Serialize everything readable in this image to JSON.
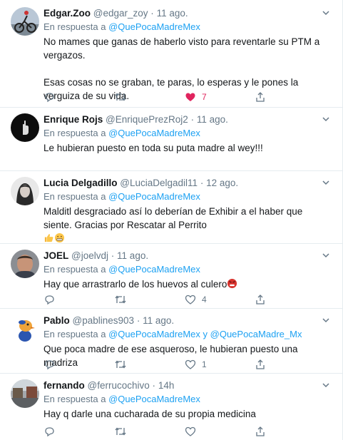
{
  "reply_prefix": "En respuesta a",
  "tweets": [
    {
      "name": "Edgar.Zoo",
      "handle": "@edgar_zoy",
      "time": "11 ago.",
      "mentions": [
        "@QuePocaMadreMex"
      ],
      "text": "No mames que ganas de haberlo visto para reventarle su PTM a vergazos.\n\nEsas cosas no se graban, te paras, lo esperas y le pones la verguiza de su vida.",
      "reply_count": "",
      "retweet_count": "",
      "like_count": "7",
      "liked": true,
      "avatar": "avatar-cyclist"
    },
    {
      "name": "Enrique Rojs",
      "handle": "@EnriquePrezRoj2",
      "time": "11 ago.",
      "mentions": [
        "@QuePocaMadreMex"
      ],
      "text": "Le hubieran puesto en toda su puta madre al wey!!!",
      "reply_count": "",
      "retweet_count": "",
      "like_count": "",
      "liked": false,
      "avatar": "avatar-dark-hand"
    },
    {
      "name": "Lucia Delgadillo",
      "handle": "@LuciaDelgadil11",
      "time": "12 ago.",
      "mentions": [
        "@QuePocaMadreMex"
      ],
      "text": "Malditl desgraciado así lo deberían  de Exhibir  a el haber que siente. Gracias  por Rescatar al Perrito",
      "text_emojis": [
        "thumbs-up-emoji",
        "grimacing-emoji"
      ],
      "reply_count": "",
      "retweet_count": "",
      "like_count": "",
      "liked": false,
      "avatar": "avatar-woman"
    },
    {
      "name": "JOEL",
      "handle": "@joelvdj",
      "time": "11 ago.",
      "mentions": [
        "@QuePocaMadreMex"
      ],
      "text": "Hay que arrastrarlo de los huevos al culero",
      "text_emojis": [
        "angry-face-emoji"
      ],
      "reply_count": "",
      "retweet_count": "",
      "like_count": "4",
      "liked": false,
      "avatar": "avatar-man"
    },
    {
      "name": "Pablo",
      "handle": "@pablines903",
      "time": "11 ago.",
      "mentions": [
        "@QuePocaMadreMex",
        "@QuePocaMadre_Mx"
      ],
      "mention_join": "y",
      "text": "Que poca madre de ese asqueroso, le hubieran puesto una madriza",
      "reply_count": "",
      "retweet_count": "",
      "like_count": "1",
      "liked": false,
      "avatar": "avatar-cartoon"
    },
    {
      "name": "fernando",
      "handle": "@ferrucochivo",
      "time": "14h",
      "mentions": [
        "@QuePocaMadreMex"
      ],
      "text": "Hay q darle una cucharada de su propia medicina",
      "reply_count": "",
      "retweet_count": "",
      "like_count": "",
      "liked": false,
      "avatar": "avatar-street"
    }
  ],
  "colors": {
    "link": "#1da1f2",
    "secondary": "#657786",
    "like": "#e0245e",
    "border": "#e6ecf0"
  }
}
